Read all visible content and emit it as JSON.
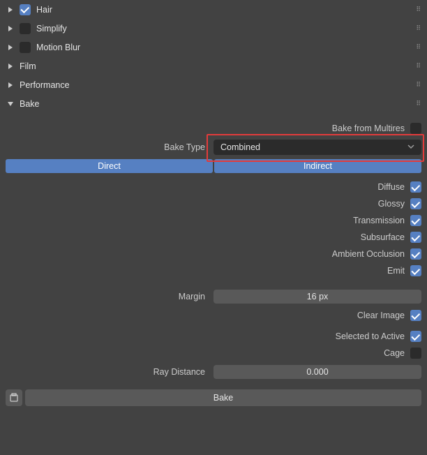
{
  "sections": {
    "hair": {
      "label": "Hair",
      "expanded": false,
      "has_checkbox": true,
      "checked": true
    },
    "simplify": {
      "label": "Simplify",
      "expanded": false,
      "has_checkbox": true,
      "checked": false
    },
    "motionblur": {
      "label": "Motion Blur",
      "expanded": false,
      "has_checkbox": true,
      "checked": false
    },
    "film": {
      "label": "Film",
      "expanded": false,
      "has_checkbox": false
    },
    "performance": {
      "label": "Performance",
      "expanded": false,
      "has_checkbox": false
    },
    "bake": {
      "label": "Bake",
      "expanded": true,
      "has_checkbox": false
    }
  },
  "bake": {
    "bake_from_multires": {
      "label": "Bake from Multires",
      "checked": false
    },
    "bake_type": {
      "label": "Bake Type",
      "value": "Combined"
    },
    "contributions": {
      "direct": {
        "label": "Direct",
        "active": true
      },
      "indirect": {
        "label": "Indirect",
        "active": true
      }
    },
    "passes": {
      "diffuse": {
        "label": "Diffuse",
        "checked": true
      },
      "glossy": {
        "label": "Glossy",
        "checked": true
      },
      "transmission": {
        "label": "Transmission",
        "checked": true
      },
      "subsurface": {
        "label": "Subsurface",
        "checked": true
      },
      "ambient_occlusion": {
        "label": "Ambient Occlusion",
        "checked": true
      },
      "emit": {
        "label": "Emit",
        "checked": true
      }
    },
    "margin": {
      "label": "Margin",
      "value": "16 px"
    },
    "clear_image": {
      "label": "Clear Image",
      "checked": true
    },
    "selected_to_active": {
      "label": "Selected to Active",
      "checked": true
    },
    "cage": {
      "label": "Cage",
      "checked": false
    },
    "ray_distance": {
      "label": "Ray Distance",
      "value": "0.000"
    },
    "bake_button": {
      "label": "Bake"
    }
  },
  "highlight": {
    "target": "bake_type_dropdown"
  },
  "colors": {
    "accent": "#5680C2",
    "highlight": "#e33b3b"
  }
}
